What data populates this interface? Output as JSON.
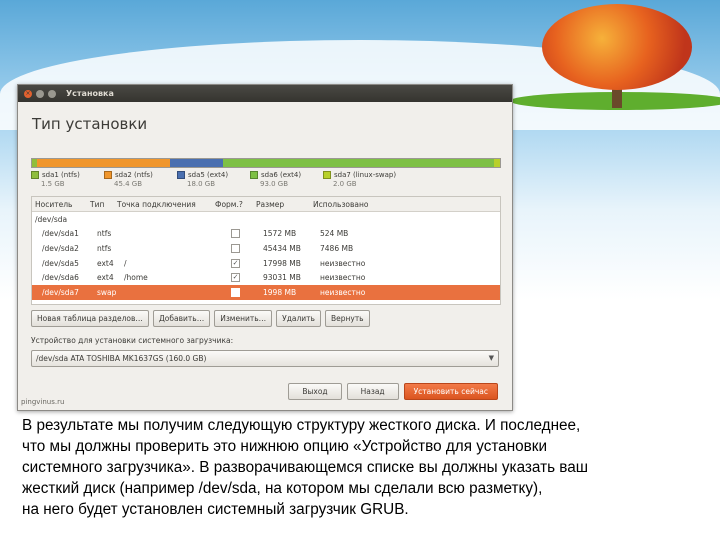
{
  "window": {
    "title": "Установка",
    "heading": "Тип установки"
  },
  "colors": {
    "ntfs_sda1": "#8fbe3c",
    "ntfs_sda2": "#f0962c",
    "ext4_sda5": "#4a6fb0",
    "ext4_sda6": "#7ec045",
    "swap_sda7": "#b8d02a",
    "selected_row": "#e9713f"
  },
  "partition_bar": [
    {
      "share": 0.0098,
      "color": "#8fbe3c"
    },
    {
      "share": 0.2869,
      "color": "#f0962c"
    },
    {
      "share": 0.1124,
      "color": "#4a6fb0"
    },
    {
      "share": 0.5813,
      "color": "#7ec045"
    },
    {
      "share": 0.0124,
      "color": "#b8d02a"
    }
  ],
  "legend": [
    {
      "label": "sda1 (ntfs)",
      "size": "1.5 GB",
      "color": "#8fbe3c"
    },
    {
      "label": "sda2 (ntfs)",
      "size": "45.4 GB",
      "color": "#f0962c"
    },
    {
      "label": "sda5 (ext4)",
      "size": "18.0 GB",
      "color": "#4a6fb0"
    },
    {
      "label": "sda6 (ext4)",
      "size": "93.0 GB",
      "color": "#7ec045"
    },
    {
      "label": "sda7 (linux-swap)",
      "size": "2.0 GB",
      "color": "#b8d02a"
    }
  ],
  "table": {
    "headers": [
      "Носитель",
      "Тип",
      "Точка подключения",
      "Форм.?",
      "Размер",
      "Использовано"
    ],
    "rows": [
      {
        "device": "/dev/sda",
        "type": "",
        "mount": "",
        "format": "",
        "size": "",
        "used": ""
      },
      {
        "device": "/dev/sda1",
        "type": "ntfs",
        "mount": "",
        "format": "",
        "size": "1572 MB",
        "used": "524 MB"
      },
      {
        "device": "/dev/sda2",
        "type": "ntfs",
        "mount": "",
        "format": "",
        "size": "45434 MB",
        "used": "7486 MB"
      },
      {
        "device": "/dev/sda5",
        "type": "ext4",
        "mount": "/",
        "format": "✓",
        "size": "17998 MB",
        "used": "неизвестно"
      },
      {
        "device": "/dev/sda6",
        "type": "ext4",
        "mount": "/home",
        "format": "✓",
        "size": "93031 MB",
        "used": "неизвестно"
      },
      {
        "device": "/dev/sda7",
        "type": "swap",
        "mount": "",
        "format": "",
        "size": "1998 MB",
        "used": "неизвестно"
      }
    ]
  },
  "buttons": {
    "new_table": "Новая таблица разделов…",
    "add": "Добавить…",
    "change": "Изменить…",
    "delete": "Удалить",
    "revert": "Вернуть"
  },
  "boot": {
    "label": "Устройство для установки системного загрузчика:",
    "value": "/dev/sda   ATA TOSHIBA MK1637GS (160.0 GB)"
  },
  "nav": {
    "quit": "Выход",
    "back": "Назад",
    "install": "Установить сейчас"
  },
  "watermark": "pingvinus.ru",
  "caption": [
    "В результате мы получим следующую структуру жесткого диска. И последнее,",
    "что мы должны проверить это нижнюю опцию «Устройство для установки",
    "системного загрузчика». В разворачивающемся списке вы должны указать ваш",
    "жесткий диск (например /dev/sda, на котором мы сделали всю разметку),",
    "на него будет установлен системный загрузчик GRUB."
  ]
}
